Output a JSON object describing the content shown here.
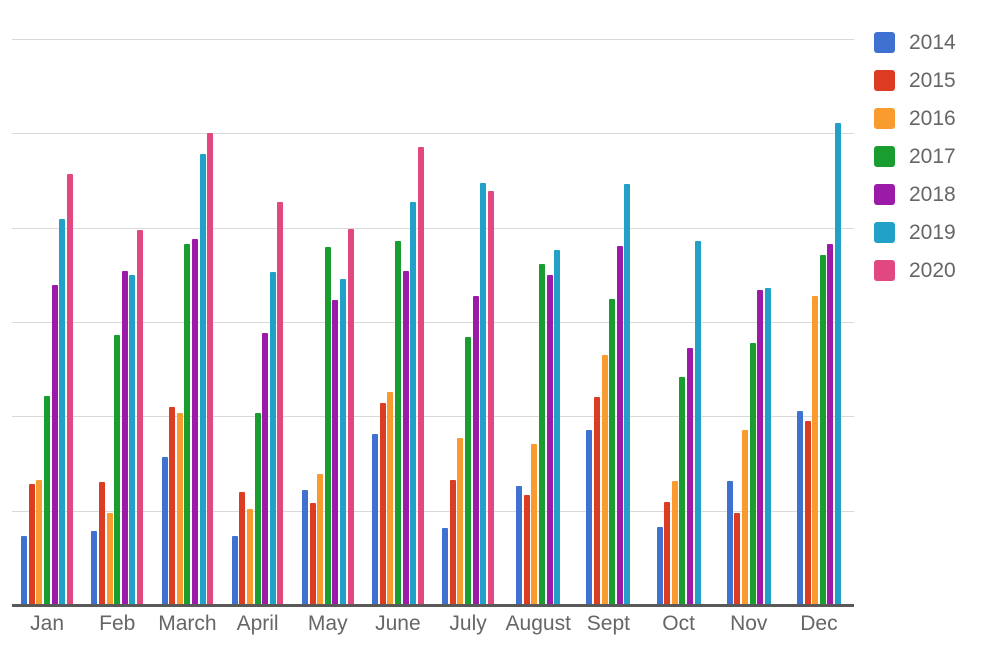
{
  "chart_data": {
    "type": "bar",
    "title": "",
    "subtitle": "",
    "xlabel": "",
    "ylabel": "",
    "grid": true,
    "legend_position": "right",
    "ylim": [
      0,
      6.2
    ],
    "y_gridlines": [
      1,
      2,
      3,
      4,
      5,
      6
    ],
    "y_tick_labels": [],
    "categories": [
      "Jan",
      "Feb",
      "March",
      "April",
      "May",
      "June",
      "July",
      "August",
      "Sept",
      "Oct",
      "Nov",
      "Dec"
    ],
    "series": [
      {
        "name": "2014",
        "color": "#3f72d0",
        "values": [
          0.73,
          0.78,
          1.57,
          0.73,
          1.22,
          1.81,
          0.82,
          1.26,
          1.85,
          0.83,
          1.31,
          2.06
        ]
      },
      {
        "name": "2015",
        "color": "#dc3c21",
        "values": [
          1.28,
          1.3,
          2.1,
          1.2,
          1.08,
          2.14,
          1.33,
          1.17,
          2.2,
          1.09,
          0.98,
          1.95
        ]
      },
      {
        "name": "2016",
        "color": "#fa9b30",
        "values": [
          1.32,
          0.98,
          2.03,
          1.02,
          1.39,
          2.26,
          1.77,
          1.71,
          2.65,
          1.31,
          1.85,
          3.27
        ]
      },
      {
        "name": "2017",
        "color": "#199d2e",
        "values": [
          2.22,
          2.86,
          3.83,
          2.03,
          3.79,
          3.86,
          2.84,
          3.61,
          3.24,
          2.42,
          2.78,
          3.71
        ]
      },
      {
        "name": "2018",
        "color": "#9c1aa8",
        "values": [
          3.39,
          3.54,
          3.88,
          2.88,
          3.23,
          3.54,
          3.28,
          3.5,
          3.81,
          2.72,
          3.34,
          3.83
        ]
      },
      {
        "name": "2019",
        "color": "#21a0c8",
        "values": [
          4.09,
          3.5,
          4.78,
          3.53,
          3.45,
          4.27,
          4.47,
          3.76,
          4.46,
          3.86,
          3.36,
          5.11
        ]
      },
      {
        "name": "2020",
        "color": "#e1487f",
        "values": [
          4.57,
          3.97,
          5.0,
          4.27,
          3.99,
          4.85,
          4.39,
          null,
          null,
          null,
          null,
          null
        ]
      }
    ]
  },
  "legend": {
    "items": [
      {
        "label": "2014",
        "color": "#3f72d0",
        "icon": "legend-swatch-icon"
      },
      {
        "label": "2015",
        "color": "#dc3c21",
        "icon": "legend-swatch-icon"
      },
      {
        "label": "2016",
        "color": "#fa9b30",
        "icon": "legend-swatch-icon"
      },
      {
        "label": "2017",
        "color": "#199d2e",
        "icon": "legend-swatch-icon"
      },
      {
        "label": "2018",
        "color": "#9c1aa8",
        "icon": "legend-swatch-icon"
      },
      {
        "label": "2019",
        "color": "#21a0c8",
        "icon": "legend-swatch-icon"
      },
      {
        "label": "2020",
        "color": "#e1487f",
        "icon": "legend-swatch-icon"
      }
    ]
  },
  "axis": {
    "x_labels": [
      "Jan",
      "Feb",
      "March",
      "April",
      "May",
      "June",
      "July",
      "August",
      "Sept",
      "Oct",
      "Nov",
      "Dec"
    ],
    "y_labels": []
  },
  "colors": {
    "gridline": "#d9d9d9",
    "axis": "#595959",
    "text": "#666666",
    "background": "#ffffff"
  }
}
